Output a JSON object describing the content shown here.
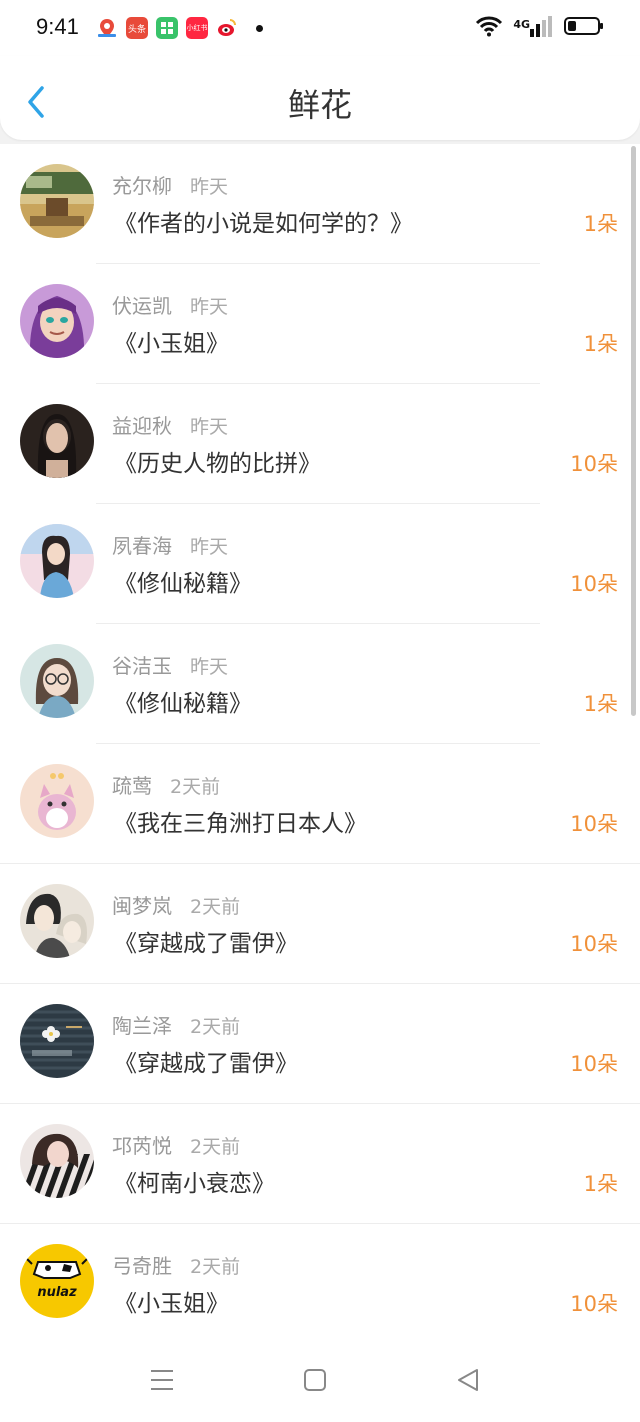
{
  "status": {
    "time": "9:41",
    "network": "4G",
    "battery_level": 0.3,
    "app_icons": [
      {
        "name": "maps-app-icon",
        "label": "",
        "color": "#ffffff"
      },
      {
        "name": "toutiao-app-icon",
        "label": "头条",
        "color": "#e84a3a"
      },
      {
        "name": "wechat-miniapp-icon",
        "label": "",
        "color": "#39c36a"
      },
      {
        "name": "xiaohongshu-app-icon",
        "label": "小红书",
        "color": "#ff2741"
      },
      {
        "name": "weibo-app-icon",
        "label": "",
        "color": "#f6b93b"
      }
    ]
  },
  "header": {
    "title": "鲜花"
  },
  "colors": {
    "accent": "#2fa4e7",
    "count": "#f0913a",
    "name": "#999999"
  },
  "items": [
    {
      "name": "充尔柳",
      "time": "昨天",
      "book": "《作者的小说是如何学的？》",
      "count": "1朵",
      "avatar": "classroom-photo"
    },
    {
      "name": "伏运凯",
      "time": "昨天",
      "book": "《小玉姐》",
      "count": "1朵",
      "avatar": "anime-girl-purple"
    },
    {
      "name": "益迎秋",
      "time": "昨天",
      "book": "《历史人物的比拼》",
      "count": "10朵",
      "avatar": "woman-dark-hair"
    },
    {
      "name": "夙春海",
      "time": "昨天",
      "book": "《修仙秘籍》",
      "count": "10朵",
      "avatar": "girl-pink-sky"
    },
    {
      "name": "谷洁玉",
      "time": "昨天",
      "book": "《修仙秘籍》",
      "count": "1朵",
      "avatar": "girl-glasses"
    },
    {
      "name": "疏莺",
      "time": "2天前",
      "book": "《我在三角洲打日本人》",
      "count": "10朵",
      "avatar": "cartoon-cat"
    },
    {
      "name": "闽梦岚",
      "time": "2天前",
      "book": "《穿越成了雷伊》",
      "count": "10朵",
      "avatar": "anime-boys"
    },
    {
      "name": "陶兰泽",
      "time": "2天前",
      "book": "《穿越成了雷伊》",
      "count": "10朵",
      "avatar": "knit-flower"
    },
    {
      "name": "邛芮悦",
      "time": "2天前",
      "book": "《柯南小衰恋》",
      "count": "1朵",
      "avatar": "girl-striped"
    },
    {
      "name": "弓奇胜",
      "time": "2天前",
      "book": "《小玉姐》",
      "count": "10朵",
      "avatar": "nulaz-cow",
      "avatar_text": "nulaz"
    }
  ]
}
